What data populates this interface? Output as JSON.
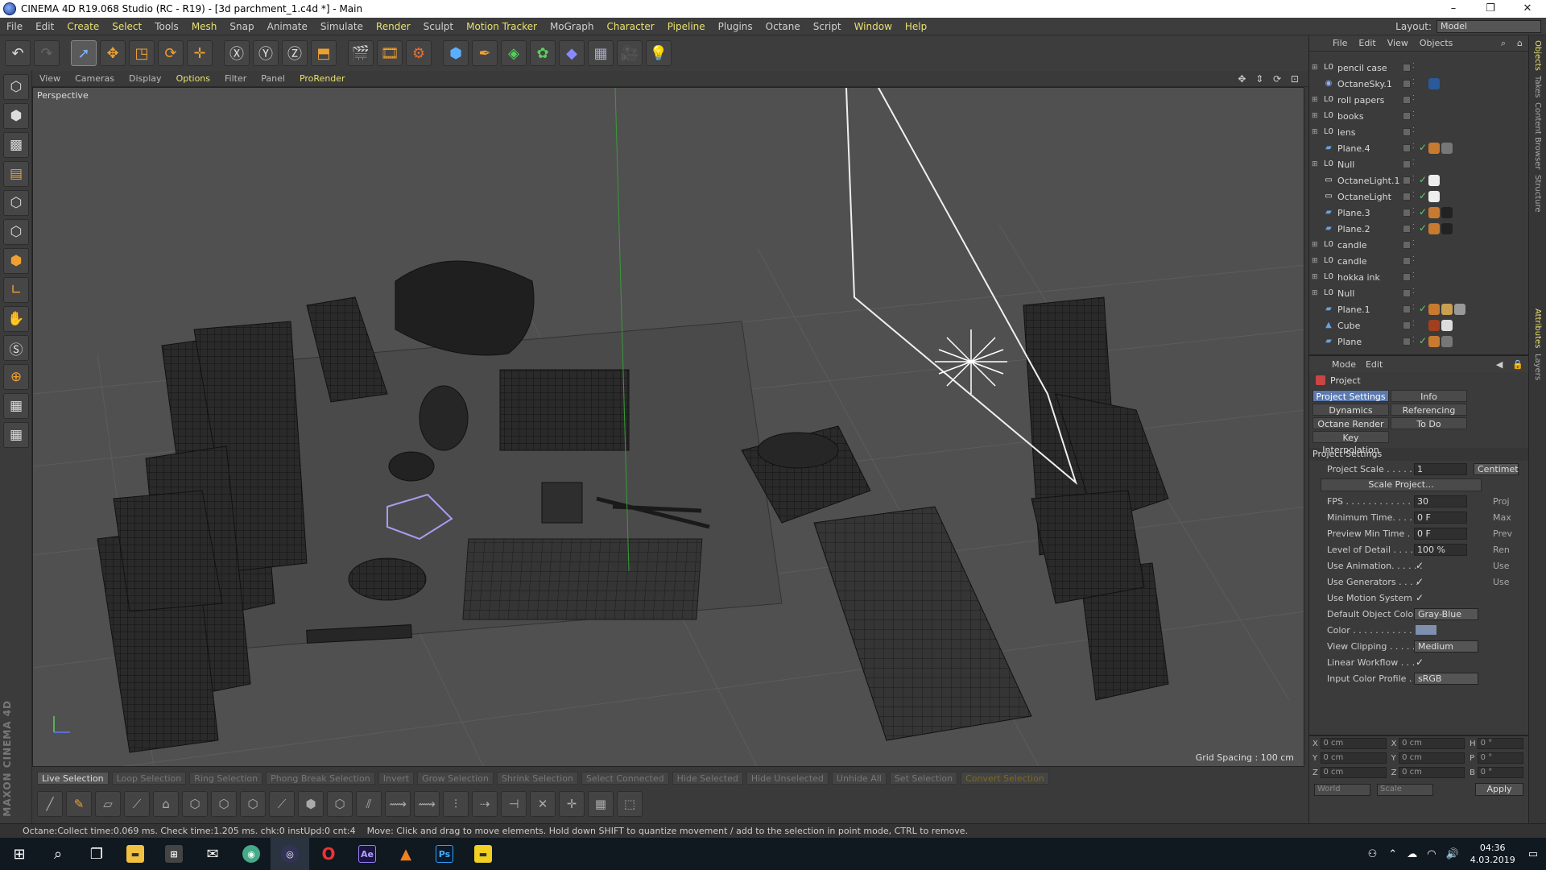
{
  "title": "CINEMA 4D R19.068 Studio (RC - R19) - [3d parchment_1.c4d *] - Main",
  "window_buttons": {
    "min": "–",
    "max": "❐",
    "close": "✕"
  },
  "menu": [
    "File",
    "Edit",
    "Create",
    "Select",
    "Tools",
    "Mesh",
    "Snap",
    "Animate",
    "Simulate",
    "Render",
    "Sculpt",
    "Motion Tracker",
    "MoGraph",
    "Character",
    "Pipeline",
    "Plugins",
    "Octane",
    "Script",
    "Window",
    "Help"
  ],
  "layout": {
    "label": "Layout:",
    "value": "Model"
  },
  "viewport": {
    "menu": [
      "View",
      "Cameras",
      "Display",
      "Options",
      "Filter",
      "Panel",
      "ProRender"
    ],
    "label": "Perspective",
    "grid_spacing": "Grid Spacing : 100 cm",
    "nav": "✥ ⇕ ⟳ ⊡"
  },
  "selection_tabs": [
    "Live Selection",
    "Loop Selection",
    "Ring Selection",
    "Phong Break Selection",
    "Invert",
    "Grow Selection",
    "Shrink Selection",
    "Select Connected",
    "Hide Selected",
    "Hide Unselected",
    "Unhide All",
    "Set Selection",
    "Convert Selection"
  ],
  "status": {
    "octane": "Octane:Collect time:0.069 ms.  Check time:1.205 ms.  chk:0  instUpd:0  cnt:4",
    "hint": "Move: Click and drag to move elements. Hold down SHIFT to quantize movement / add to the selection in point mode, CTRL to remove."
  },
  "maxon": "MAXON CINEMA 4D",
  "objects": {
    "menu": [
      "File",
      "Edit",
      "View",
      "Objects"
    ],
    "items": [
      {
        "name": "pencil case",
        "icon": "null-icon",
        "tick": false,
        "tags": []
      },
      {
        "name": "OctaneSky.1",
        "icon": "sky-icon",
        "tick": false,
        "tags": [
          "#2a5a9a"
        ]
      },
      {
        "name": "roll papers",
        "icon": "null-icon",
        "tick": false,
        "tags": []
      },
      {
        "name": "books",
        "icon": "null-icon",
        "tick": false,
        "tags": []
      },
      {
        "name": "lens",
        "icon": "null-icon",
        "tick": false,
        "tags": []
      },
      {
        "name": "Plane.4",
        "icon": "plane-icon",
        "tick": true,
        "tags": [
          "#c87a30",
          "#777"
        ]
      },
      {
        "name": "Null",
        "icon": "null-icon",
        "tick": false,
        "tags": []
      },
      {
        "name": "OctaneLight.1",
        "icon": "light-icon",
        "tick": true,
        "tags": [
          "#eee"
        ]
      },
      {
        "name": "OctaneLight",
        "icon": "light-icon",
        "tick": true,
        "tags": [
          "#eee"
        ]
      },
      {
        "name": "Plane.3",
        "icon": "plane-icon",
        "tick": true,
        "tags": [
          "#c87a30",
          "#222"
        ]
      },
      {
        "name": "Plane.2",
        "icon": "plane-icon",
        "tick": true,
        "tags": [
          "#c87a30",
          "#222"
        ]
      },
      {
        "name": "candle",
        "icon": "null-icon",
        "tick": false,
        "tags": []
      },
      {
        "name": "candle",
        "icon": "null-icon",
        "tick": false,
        "tags": []
      },
      {
        "name": "hokka ink",
        "icon": "null-icon",
        "tick": false,
        "tags": []
      },
      {
        "name": "Null",
        "icon": "null-icon",
        "tick": false,
        "tags": []
      },
      {
        "name": "Plane.1",
        "icon": "plane-icon",
        "tick": true,
        "tags": [
          "#c87a30",
          "#c8a050",
          "#999"
        ]
      },
      {
        "name": "Cube",
        "icon": "cube-icon",
        "tick": false,
        "tags": [
          "#a04020",
          "#ddd"
        ]
      },
      {
        "name": "Plane",
        "icon": "plane-icon",
        "tick": true,
        "tags": [
          "#c87a30",
          "#777"
        ]
      }
    ]
  },
  "attributes": {
    "menu": [
      "Mode",
      "Edit"
    ],
    "title": "Project",
    "tabs": [
      "Project Settings",
      "Info",
      "Dynamics",
      "Referencing",
      "Octane Render",
      "To Do",
      "Key Interpolation"
    ],
    "section": "Project Settings",
    "project_scale": {
      "label": "Project Scale . . . . . .",
      "value": "1",
      "unit": "Centimet"
    },
    "scale_button": "Scale Project...",
    "fps": {
      "label": "FPS . . . . . . . . . . . . .",
      "value": "30",
      "right": "Proj"
    },
    "min_time": {
      "label": "Minimum Time. . . . .",
      "value": "0 F",
      "right": "Max"
    },
    "preview_min": {
      "label": "Preview Min Time . .",
      "value": "0 F",
      "right": "Prev"
    },
    "lod": {
      "label": "Level of Detail . . . . .",
      "value": "100 %",
      "right": "Ren"
    },
    "use_anim": {
      "label": "Use Animation. . . . . .",
      "check": "✓",
      "right": "Use"
    },
    "use_gen": {
      "label": "Use Generators . . . .",
      "check": "✓",
      "right": "Use"
    },
    "use_motion": {
      "label": "Use Motion System",
      "check": "✓"
    },
    "def_color": {
      "label": "Default Object Color",
      "value": "Gray-Blue"
    },
    "color": {
      "label": "Color . . . . . . . . . . ."
    },
    "clipping": {
      "label": "View Clipping . . . . .",
      "value": "Medium"
    },
    "linear": {
      "label": "Linear Workflow . . .",
      "check": "✓"
    },
    "input_profile": {
      "label": "Input Color Profile . .",
      "value": "sRGB"
    }
  },
  "coords": {
    "rows": [
      [
        "X",
        "0 cm",
        "X",
        "0 cm",
        "H",
        "0 °"
      ],
      [
        "Y",
        "0 cm",
        "Y",
        "0 cm",
        "P",
        "0 °"
      ],
      [
        "Z",
        "0 cm",
        "Z",
        "0 cm",
        "B",
        "0 °"
      ]
    ],
    "world": "World",
    "scale": "Scale",
    "apply": "Apply"
  },
  "right_tabs": [
    "Objects",
    "Takes",
    "Content Browser",
    "Structure",
    "Attributes",
    "Layers"
  ],
  "taskbar": {
    "time": "04:36",
    "date": "4.03.2019",
    "apps": [
      "Ae",
      "Ps"
    ]
  }
}
